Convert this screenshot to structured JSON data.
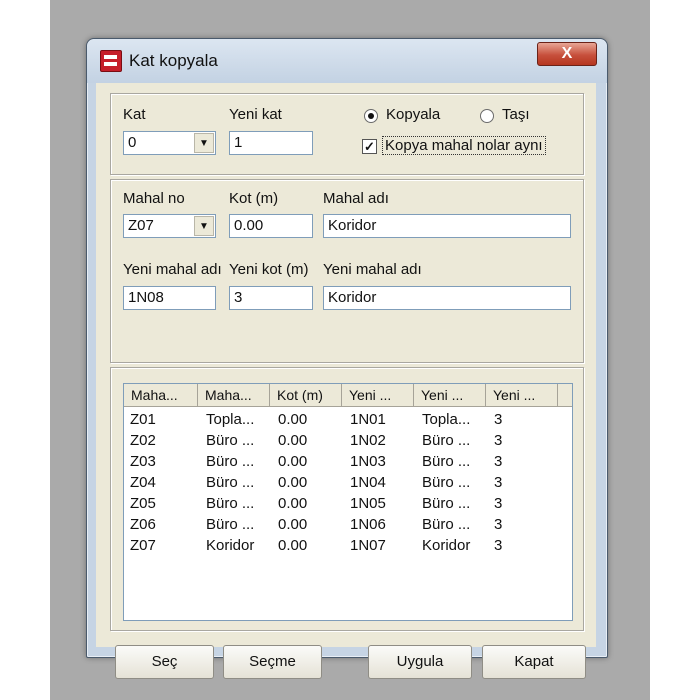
{
  "window": {
    "title": "Kat kopyala",
    "close_glyph": "X"
  },
  "top_group": {
    "kat_label": "Kat",
    "kat_value": "0",
    "yeni_kat_label": "Yeni kat",
    "yeni_kat_value": "1",
    "radio_kopyala": "Kopyala",
    "radio_tasi": "Taşı",
    "checkbox_label": "Kopya mahal nolar aynı",
    "checkbox_checked": true,
    "selected_mode": "Kopyala"
  },
  "mid_group": {
    "mahal_no_label": "Mahal no",
    "mahal_no_value": "Z07",
    "kot_label": "Kot (m)",
    "kot_value": "0.00",
    "mahal_adi_label": "Mahal adı",
    "mahal_adi_value": "Koridor",
    "yeni_mahal_no_label": "Yeni mahal adı",
    "yeni_mahal_no_value": "1N08",
    "yeni_kot_label": "Yeni kot (m)",
    "yeni_kot_value": "3",
    "yeni_mahal_adi_label": "Yeni mahal adı",
    "yeni_mahal_adi_value": "Koridor"
  },
  "list": {
    "columns": [
      "Maha...",
      "Maha...",
      "Kot (m)",
      "Yeni ...",
      "Yeni ...",
      "Yeni ..."
    ],
    "rows": [
      [
        "Z01",
        "Topla...",
        "0.00",
        "1N01",
        "Topla...",
        "3"
      ],
      [
        "Z02",
        "Büro ...",
        "0.00",
        "1N02",
        "Büro ...",
        "3"
      ],
      [
        "Z03",
        "Büro ...",
        "0.00",
        "1N03",
        "Büro ...",
        "3"
      ],
      [
        "Z04",
        "Büro ...",
        "0.00",
        "1N04",
        "Büro ...",
        "3"
      ],
      [
        "Z05",
        "Büro ...",
        "0.00",
        "1N05",
        "Büro ...",
        "3"
      ],
      [
        "Z06",
        "Büro ...",
        "0.00",
        "1N06",
        "Büro ...",
        "3"
      ],
      [
        "Z07",
        "Koridor",
        "0.00",
        "1N07",
        "Koridor",
        "3"
      ]
    ]
  },
  "buttons": {
    "sec": "Seç",
    "secme": "Seçme",
    "uygula": "Uygula",
    "kapat": "Kapat"
  },
  "icons": {
    "app": "app-icon",
    "dropdown": "chevron-down-icon"
  },
  "colors": {
    "window_frame": "#c6d4e4",
    "client_bg": "#ece9d8",
    "close_button": "#c7503c"
  }
}
